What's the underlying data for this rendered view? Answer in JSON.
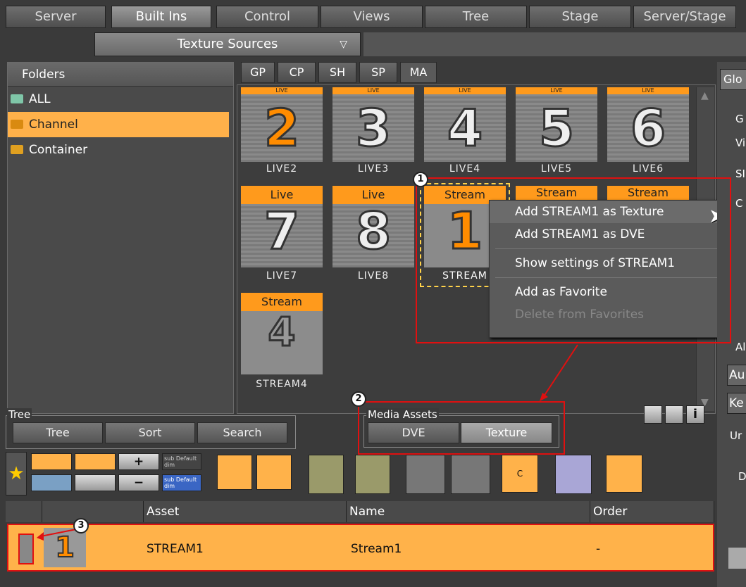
{
  "top_tabs": [
    "Server",
    "Built Ins",
    "Control",
    "Views",
    "Tree",
    "Stage",
    "Server/Stage"
  ],
  "selector": {
    "value": "Texture Sources"
  },
  "folders": {
    "header": "Folders",
    "items": [
      "ALL",
      "Channel",
      "Container"
    ]
  },
  "sub_tabs": [
    "GP",
    "CP",
    "SH",
    "SP",
    "MA"
  ],
  "assets": [
    {
      "tag": "LIVE",
      "num": "2",
      "caption": "LIVE2"
    },
    {
      "tag": "LIVE",
      "num": "3",
      "caption": "LIVE3"
    },
    {
      "tag": "LIVE",
      "num": "4",
      "caption": "LIVE4"
    },
    {
      "tag": "LIVE",
      "num": "5",
      "caption": "LIVE5"
    },
    {
      "tag": "LIVE",
      "num": "6",
      "caption": "LIVE6"
    },
    {
      "tag": "Live",
      "num": "7",
      "caption": "LIVE7"
    },
    {
      "tag": "Live",
      "num": "8",
      "caption": "LIVE8"
    },
    {
      "tag": "Stream",
      "num": "1",
      "caption": "STREAM"
    },
    {
      "tag": "Stream",
      "num": "",
      "caption": ""
    },
    {
      "tag": "Stream",
      "num": "",
      "caption": ""
    },
    {
      "tag": "Stream",
      "num": "4",
      "caption": "STREAM4"
    }
  ],
  "context_menu": {
    "items": [
      "Add STREAM1 as Texture",
      "Add STREAM1 as DVE",
      "Show settings of STREAM1",
      "Add as Favorite",
      "Delete from Favorites"
    ]
  },
  "callouts": [
    "1",
    "2",
    "3"
  ],
  "tree_group": {
    "title": "Tree",
    "buttons": [
      "Tree",
      "Sort",
      "Search"
    ]
  },
  "media_assets": {
    "title": "Media Assets",
    "buttons": [
      "DVE",
      "Texture"
    ]
  },
  "right_panel": {
    "labels": [
      "Glo",
      "G",
      "Vi",
      "SI",
      "C",
      "Al",
      "Au",
      "Ke",
      "Ur",
      "D"
    ]
  },
  "toolbar_small_text": {
    "a": "sub Default dim",
    "b": "sub Default dim",
    "c": "C"
  },
  "table": {
    "columns": [
      "Asset",
      "Name",
      "Order"
    ],
    "rows": [
      {
        "thumb_num": "1",
        "asset": "STREAM1",
        "name": "Stream1",
        "order": "-"
      }
    ]
  }
}
